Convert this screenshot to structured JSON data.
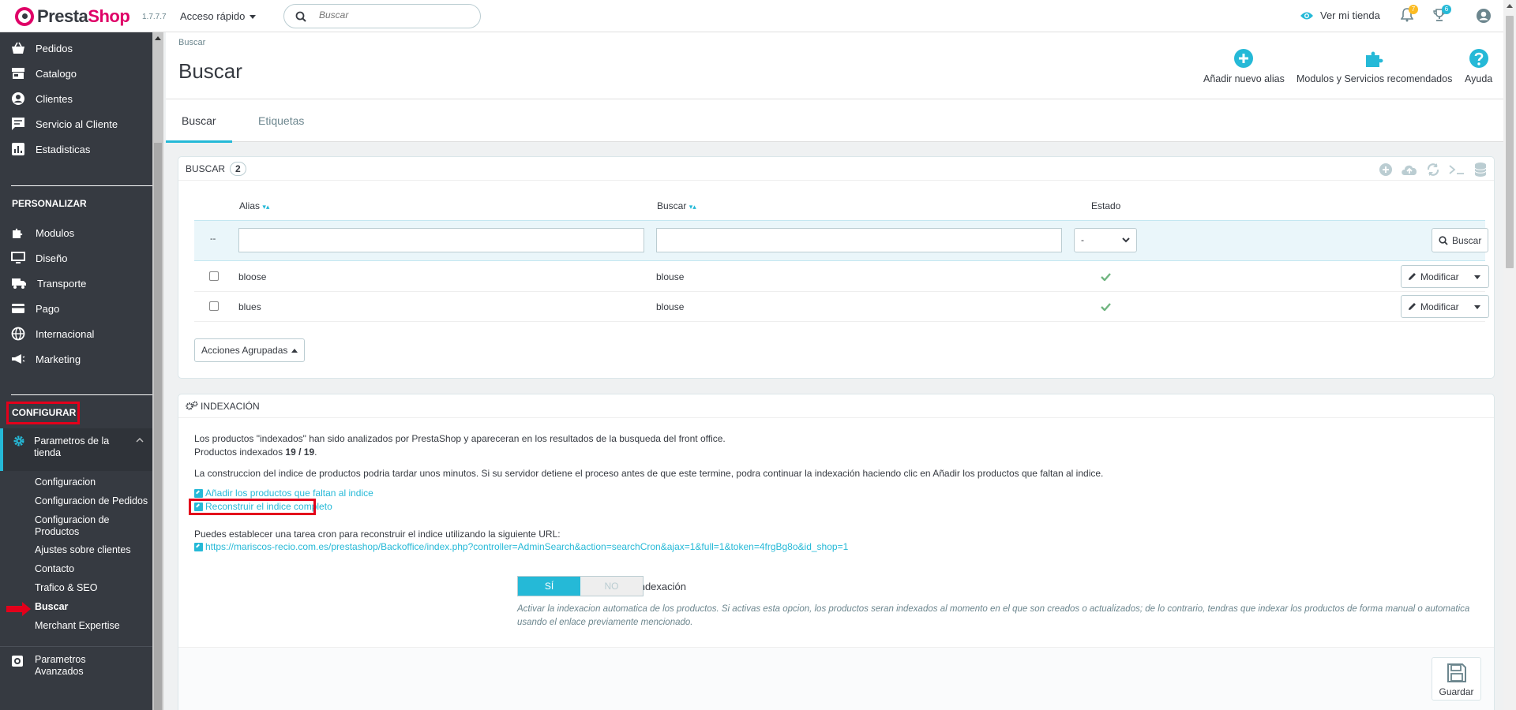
{
  "header": {
    "logo_part1": "Presta",
    "logo_part2": "Shop",
    "version": "1.7.7.7",
    "quick_access": "Acceso rápido",
    "search_placeholder": "Buscar",
    "view_store": "Ver mi tienda",
    "notif_orders": "7",
    "notif_customers": "6"
  },
  "sidebar": {
    "items_top": [
      {
        "label": "Pedidos",
        "icon": "basket-icon"
      },
      {
        "label": "Catalogo",
        "icon": "store-icon"
      },
      {
        "label": "Clientes",
        "icon": "user-circle-icon"
      },
      {
        "label": "Servicio al Cliente",
        "icon": "chat-icon"
      },
      {
        "label": "Estadisticas",
        "icon": "chart-icon"
      }
    ],
    "section_personalizar": "PERSONALIZAR",
    "items_personalizar": [
      {
        "label": "Modulos",
        "icon": "puzzle-icon"
      },
      {
        "label": "Diseño",
        "icon": "monitor-icon"
      },
      {
        "label": "Transporte",
        "icon": "truck-icon"
      },
      {
        "label": "Pago",
        "icon": "card-icon"
      },
      {
        "label": "Internacional",
        "icon": "globe-icon"
      },
      {
        "label": "Marketing",
        "icon": "megaphone-icon"
      }
    ],
    "section_configurar": "CONFIGURAR",
    "active_item": "Parametros de la tienda",
    "sub_items": [
      "Configuracion",
      "Configuracion de Pedidos",
      "Configuracion de Productos",
      "Ajustes sobre clientes",
      "Contacto",
      "Trafico & SEO",
      "Buscar",
      "Merchant Expertise"
    ],
    "advanced": "Parametros Avanzados"
  },
  "page": {
    "breadcrumb": "Buscar",
    "title": "Buscar",
    "toolbar": {
      "add_alias": "Añadir nuevo alias",
      "modules": "Modulos y Servicios recomendados",
      "help": "Ayuda"
    },
    "tabs": [
      "Buscar",
      "Etiquetas"
    ]
  },
  "list_panel": {
    "title": "BUSCAR",
    "count": "2",
    "columns": [
      "Alias",
      "Buscar",
      "Estado"
    ],
    "filter_dash": "--",
    "filter_select": "-",
    "search_button": "Buscar",
    "rows": [
      {
        "alias": "bloose",
        "search": "blouse",
        "enabled": true
      },
      {
        "alias": "blues",
        "search": "blouse",
        "enabled": true
      }
    ],
    "edit_label": "Modificar",
    "bulk_actions": "Acciones Agrupadas"
  },
  "index_panel": {
    "title": "INDEXACIÓN",
    "intro": "Los productos \"indexados\" han sido analizados por PrestaShop y apareceran en los resultados de la busqueda del front office.",
    "indexed_label": "Productos indexados",
    "indexed_value": "19 / 19",
    "build_note": "La construccion del indice de productos podria tardar unos minutos. Si su servidor detiene el proceso antes de que este termine, podra continuar la indexación haciendo clic en Añadir los productos que faltan al indice.",
    "link_add": "Añadir los productos que faltan al indice",
    "link_rebuild": "Reconstruir el indice completo",
    "cron_note": "Puedes establecer una tarea cron para reconstruir el indice utilizando la siguiente URL:",
    "cron_url": "https://mariscos-recio.com.es/prestashop/Backoffice/index.php?controller=AdminSearch&action=searchCron&ajax=1&full=1&token=4frgBg8o&id_shop=1",
    "indexation_label": "Indexación",
    "toggle_yes": "SÍ",
    "toggle_no": "NO",
    "help_text": "Activar la indexacion automatica de los productos. Si activas esta opcion, los productos seran indexados al momento en el que son creados o actualizados; de lo contrario, tendras que indexar los productos de forma manual o automatica usando el enlace previamente mencionado.",
    "save": "Guardar"
  },
  "colors": {
    "accent": "#25b9d7",
    "sidebar": "#363a41",
    "brand": "#df0067",
    "success": "#70b580",
    "highlight": "#e3001b"
  }
}
